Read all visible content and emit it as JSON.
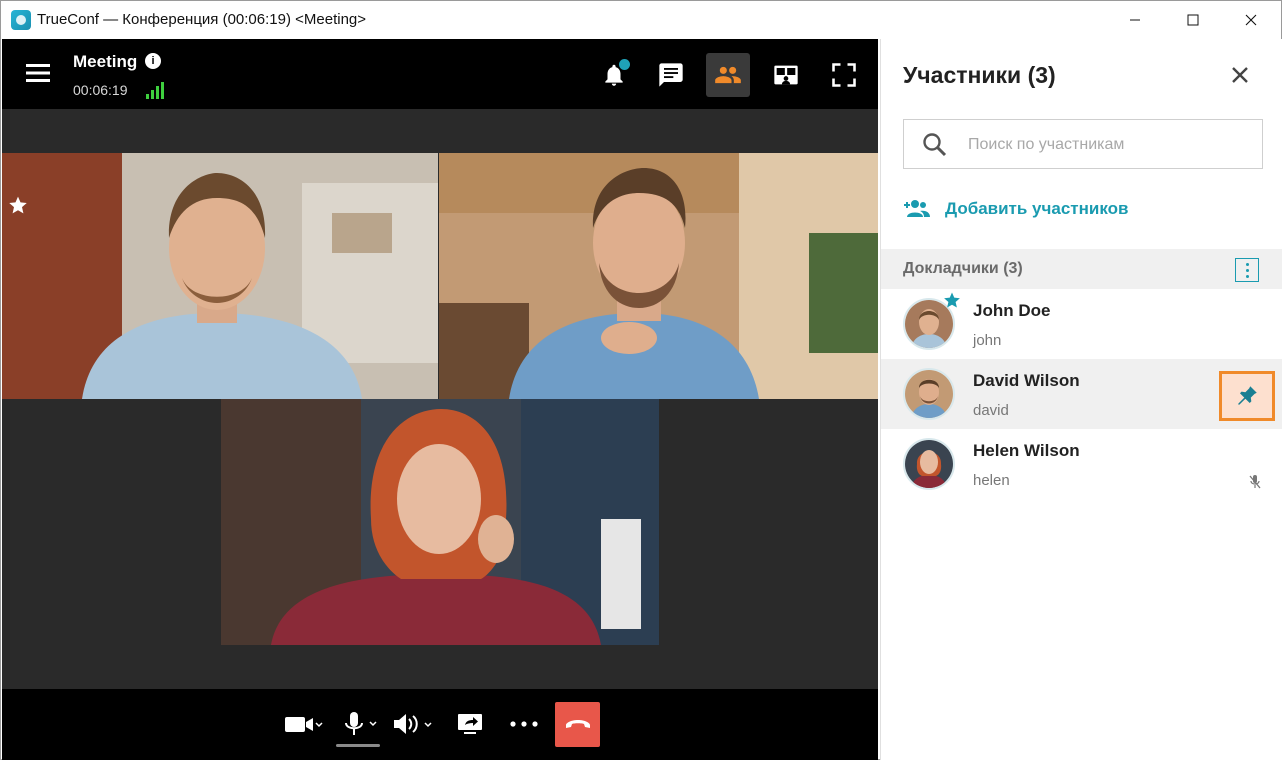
{
  "window": {
    "title": "TrueConf — Конференция (00:06:19) <Meeting>"
  },
  "meeting": {
    "name": "Meeting",
    "timer": "00:06:19"
  },
  "top_toolbar": {
    "icons": [
      "notifications-icon",
      "chat-icon",
      "participants-icon",
      "layout-icon",
      "fullscreen-icon"
    ],
    "active": "participants-icon"
  },
  "bottom_toolbar": {
    "icons": [
      "camera-icon",
      "microphone-icon",
      "speaker-icon",
      "share-screen-icon",
      "more-icon",
      "hangup-icon"
    ]
  },
  "panel": {
    "title": "Участники (3)",
    "search_placeholder": "Поиск по участникам",
    "add_label": "Добавить участников",
    "section_label": "Докладчики (3)",
    "participants": [
      {
        "name": "John Doe",
        "login": "john",
        "starred": true
      },
      {
        "name": "David Wilson",
        "login": "david",
        "pinned_hover": true
      },
      {
        "name": "Helen Wilson",
        "login": "helen",
        "muted": true
      }
    ]
  },
  "colors": {
    "accent": "#1a9bb0",
    "hangup": "#e8574a",
    "pin_highlight": "#f08a2a",
    "active_participants_icon": "#f08a2a"
  }
}
